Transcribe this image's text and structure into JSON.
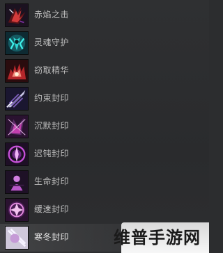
{
  "skills": [
    {
      "label": "赤焰之击",
      "icon": "red-flame-strike-icon",
      "accent": "#c23a3a"
    },
    {
      "label": "灵魂守护",
      "icon": "cyan-soul-guard-icon",
      "accent": "#2fd3d0"
    },
    {
      "label": "窃取精华",
      "icon": "red-essence-steal-icon",
      "accent": "#b3262a"
    },
    {
      "label": "约束封印",
      "icon": "purple-bind-seal-icon",
      "accent": "#9a6fd1"
    },
    {
      "label": "沉默封印",
      "icon": "magenta-silence-seal-icon",
      "accent": "#c23fae"
    },
    {
      "label": "迟钝封印",
      "icon": "violet-slow-seal-icon",
      "accent": "#c64fd8"
    },
    {
      "label": "生命封印",
      "icon": "violet-life-seal-icon",
      "accent": "#b957c9"
    },
    {
      "label": "缓速封印",
      "icon": "pink-haste-seal-icon",
      "accent": "#d85ad0"
    },
    {
      "label": "寒冬封印",
      "icon": "pale-winter-seal-icon",
      "accent": "#ddd7e8"
    }
  ],
  "watermark": {
    "text": "维普手游网"
  }
}
